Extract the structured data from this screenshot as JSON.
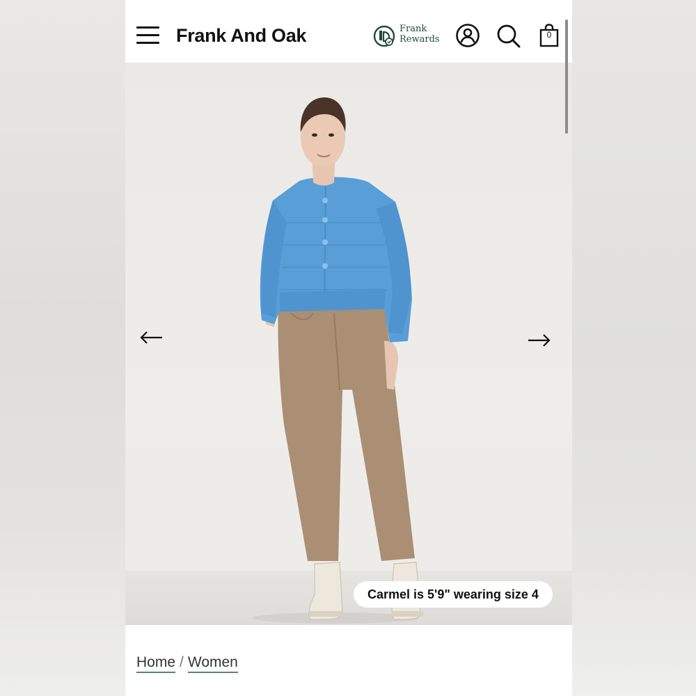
{
  "header": {
    "brand": "Frank And Oak",
    "rewards_line1": "Frank",
    "rewards_line2": "Rewards",
    "cart_count": "0"
  },
  "gallery": {
    "model_note": "Carmel is 5'9\" wearing size 4"
  },
  "breadcrumb": {
    "home": "Home",
    "separator": "/",
    "current": "Women"
  },
  "colors": {
    "brand_green": "#1f4a3c",
    "cardigan_blue": "#5a9ed8",
    "pants_tan": "#ab8f74"
  },
  "icons": [
    "hamburger-icon",
    "frank-rewards-logo-icon",
    "account-icon",
    "search-icon",
    "shopping-bag-icon",
    "arrow-left-icon",
    "arrow-right-icon"
  ]
}
